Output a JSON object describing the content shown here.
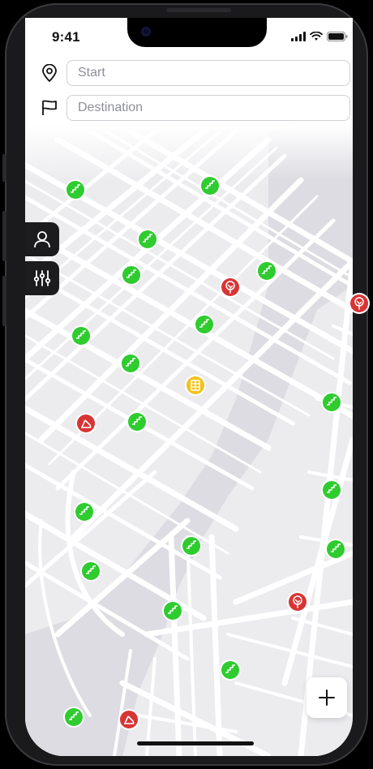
{
  "status_bar": {
    "time": "9:41",
    "icons": [
      "signal-icon",
      "wifi-icon",
      "battery-icon"
    ]
  },
  "route": {
    "start": {
      "placeholder": "Start",
      "icon": "location-pin-icon"
    },
    "destination": {
      "placeholder": "Destination",
      "icon": "flag-icon"
    }
  },
  "sidebar": [
    {
      "name": "profile-button",
      "icon": "user-icon"
    },
    {
      "name": "filter-button",
      "icon": "sliders-icon"
    }
  ],
  "map": {
    "marker_types": {
      "stairs": {
        "color": "#2ecc2e",
        "icon": "stairs-icon"
      },
      "tree": {
        "color": "#d93434",
        "icon": "tree-icon"
      },
      "ramp": {
        "color": "#d93434",
        "icon": "ramp-icon"
      },
      "building": {
        "color": "#f2c21a",
        "icon": "building-icon"
      }
    }
  },
  "fab": {
    "icon": "plus-icon"
  },
  "colors": {
    "stairs": "#2ecc2e",
    "warning": "#d93434",
    "building": "#f2c21a",
    "dark_button": "#1c1c1e"
  }
}
